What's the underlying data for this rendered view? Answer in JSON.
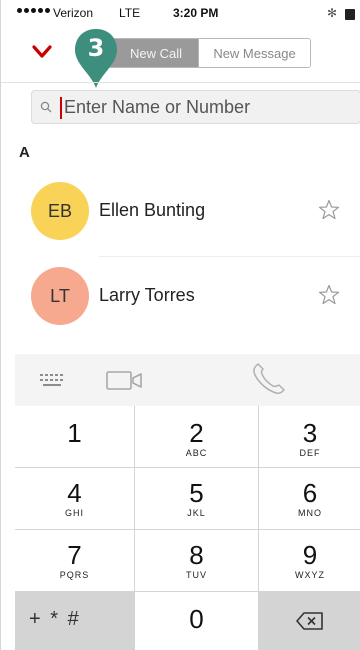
{
  "status_bar": {
    "carrier": "Verizon",
    "network": "LTE",
    "time": "3:20 PM"
  },
  "header": {
    "back_icon": "chevron-down-icon",
    "segments": [
      "New Call",
      "New Message"
    ],
    "selected_segment": "New Call",
    "step_badge": "3"
  },
  "search": {
    "placeholder": "Enter Name or Number",
    "icon": "search-icon"
  },
  "contacts": {
    "section_letter": "A",
    "items": [
      {
        "initials": "EB",
        "name": "Ellen Bunting",
        "color": "#f9d258",
        "favorite_icon": "star-outline-icon"
      },
      {
        "initials": "LT",
        "name": "Larry Torres",
        "color": "#f6a98e",
        "favorite_icon": "star-outline-icon"
      }
    ]
  },
  "actions": {
    "icons": [
      "keypad-icon",
      "video-call-icon",
      "phone-icon"
    ]
  },
  "keypad": {
    "keys": [
      {
        "digit": "1",
        "letters": ""
      },
      {
        "digit": "2",
        "letters": "ABC"
      },
      {
        "digit": "3",
        "letters": "DEF"
      },
      {
        "digit": "4",
        "letters": "GHI"
      },
      {
        "digit": "5",
        "letters": "JKL"
      },
      {
        "digit": "6",
        "letters": "MNO"
      },
      {
        "digit": "7",
        "letters": "PQRS"
      },
      {
        "digit": "8",
        "letters": "TUV"
      },
      {
        "digit": "9",
        "letters": "WXYZ"
      }
    ],
    "symbols": "+ * #",
    "zero": "0",
    "delete_icon": "backspace-icon"
  },
  "colors": {
    "accent_red": "#cc0000",
    "pin_green": "#3e8e7e"
  }
}
